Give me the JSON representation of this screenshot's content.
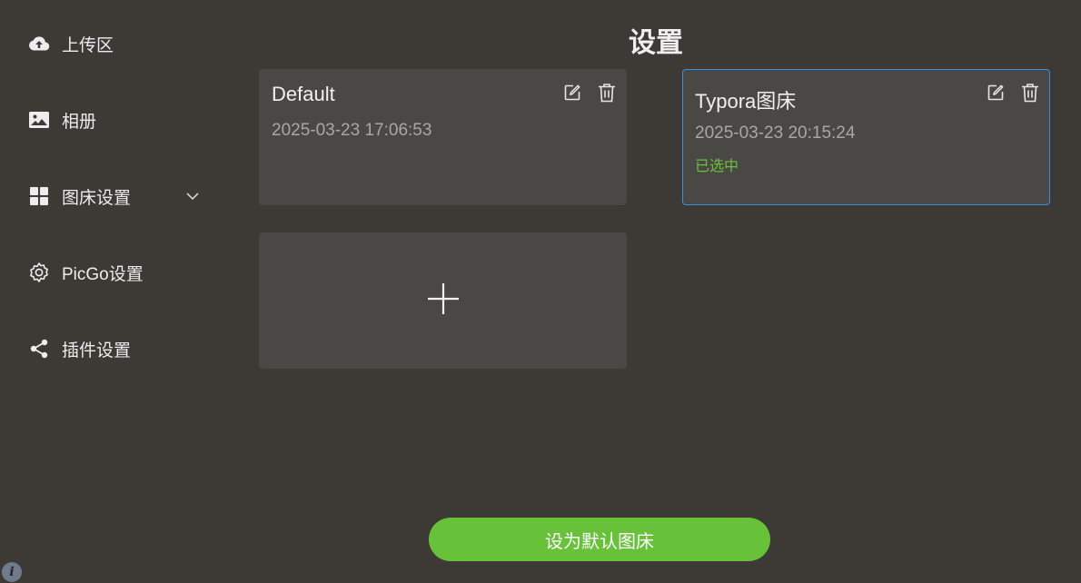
{
  "sidebar": {
    "items": [
      {
        "label": "上传区",
        "icon": "cloud-upload-icon"
      },
      {
        "label": "相册",
        "icon": "image-icon"
      },
      {
        "label": "图床设置",
        "icon": "grid-icon",
        "expand_icon": "chevron-down-icon"
      },
      {
        "label": "PicGo设置",
        "icon": "gear-icon"
      },
      {
        "label": "插件设置",
        "icon": "share-icon"
      }
    ]
  },
  "header": {
    "title": "设置"
  },
  "configs": [
    {
      "name": "Default",
      "date": "2025-03-23 17:06:53",
      "selected": false
    },
    {
      "name": "Typora图床",
      "date": "2025-03-23 20:15:24",
      "selected": true,
      "status": "已选中"
    }
  ],
  "add_card": {
    "icon": "plus-icon"
  },
  "actions": {
    "set_default_label": "设为默认图床"
  },
  "footer": {
    "info_glyph": "i",
    "info_icon": "info-icon"
  },
  "colors": {
    "background": "#3d3a36",
    "card": "#4a4845",
    "accent_green": "#67c23a",
    "selected_border": "#3a8ee6",
    "muted_text": "#a9a7a4"
  }
}
